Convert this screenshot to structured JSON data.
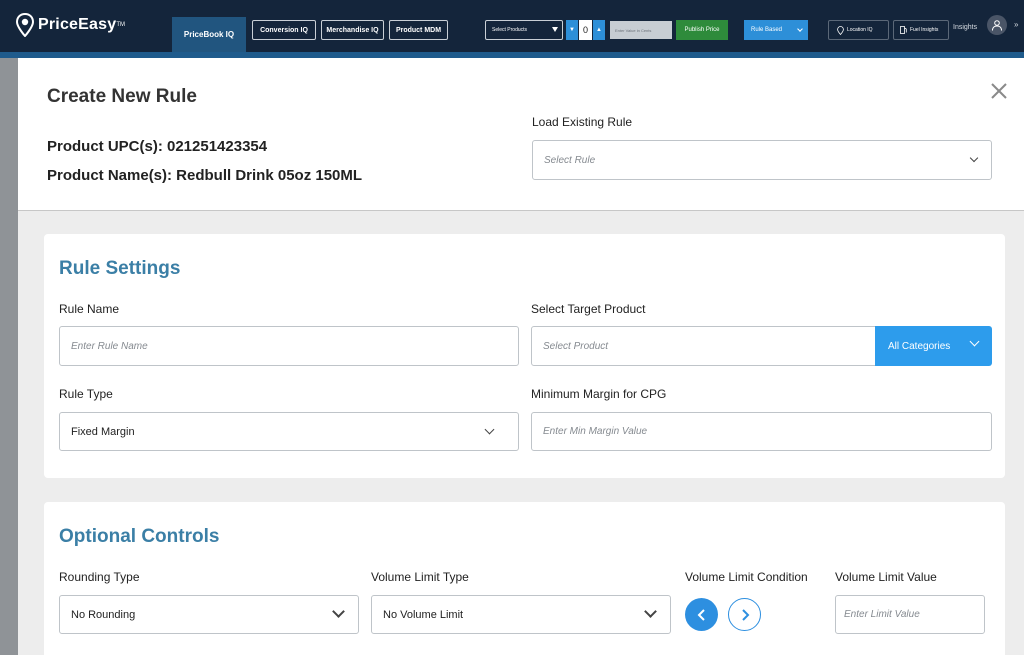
{
  "app": {
    "logo_text": "PriceEasy",
    "logo_tm": "TM"
  },
  "nav": {
    "tabs": [
      {
        "label": "PriceBook IQ",
        "active": true
      },
      {
        "label": "Conversion IQ"
      },
      {
        "label": "Merchandise IQ"
      },
      {
        "label": "Product MDM"
      }
    ],
    "select_products": "Select Products",
    "stepper_value": "0",
    "value_input_placeholder": "Enter Value in Cents",
    "publish_price": "Publish Price",
    "rule_based": "Rule Based",
    "location_iq": "Location IQ",
    "fuel_insights": "Fuel Insights",
    "insights": "Insights"
  },
  "modal": {
    "title": "Create New Rule",
    "upc_line": "Product UPC(s):  021251423354",
    "name_line": "Product Name(s): Redbull Drink 05oz 150ML",
    "load_existing_label": "Load Existing Rule",
    "load_existing_placeholder": "Select Rule"
  },
  "rule_settings": {
    "title": "Rule Settings",
    "rule_name_label": "Rule Name",
    "rule_name_placeholder": "Enter Rule Name",
    "target_product_label": "Select Target Product",
    "target_product_placeholder": "Select Product",
    "category_button": "All Categories",
    "rule_type_label": "Rule Type",
    "rule_type_value": "Fixed Margin",
    "min_margin_label": "Minimum Margin for CPG",
    "min_margin_placeholder": "Enter Min Margin Value"
  },
  "optional_controls": {
    "title": "Optional Controls",
    "rounding_label": "Rounding Type",
    "rounding_value": "No Rounding",
    "volume_type_label": "Volume Limit Type",
    "volume_type_value": "No Volume Limit",
    "volume_condition_label": "Volume Limit Condition",
    "volume_value_label": "Volume Limit Value",
    "volume_value_placeholder": "Enter Limit Value"
  },
  "colors": {
    "topbar": "#14253b",
    "accent_blue": "#2d8fe0",
    "section_title": "#3b7fa6",
    "publish_green": "#2e8b3b"
  }
}
